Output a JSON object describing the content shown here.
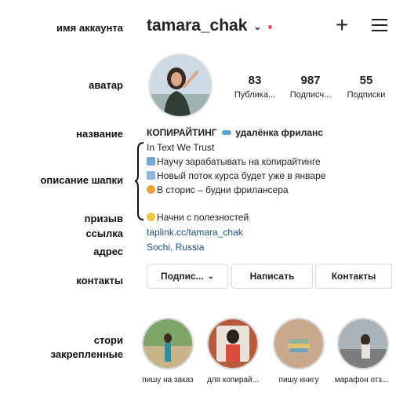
{
  "annotations": {
    "account_name": "имя аккаунта",
    "avatar": "аватар",
    "title": "название",
    "header_description": "описание шапки",
    "call_to_action": "призыв",
    "link": "ссылка",
    "address": "адрес",
    "contacts": "контакты",
    "stories_line1": "стори",
    "stories_line2": "закрепленные"
  },
  "header": {
    "username": "tamara_chak",
    "icons": [
      "chevron-down-icon",
      "notification-dot",
      "plus-icon",
      "menu-icon"
    ]
  },
  "stats": [
    {
      "value": "83",
      "label": "Публика..."
    },
    {
      "value": "987",
      "label": "Подписч..."
    },
    {
      "value": "55",
      "label": "Подписки"
    }
  ],
  "bio": {
    "name": "КОПИРАЙТИНГ",
    "category": "удалёнка фриланс",
    "lines": [
      "In Text We Trust",
      "Научу зарабатывать на копирайтинге",
      "Новый поток курса будет уже в январе",
      "В сторис – будни фрилансера",
      "Начни с полезностей"
    ],
    "link": "taplink.cc/tamara_chak",
    "address": "Sochi, Russia"
  },
  "buttons": {
    "subscribe": "Подпис...",
    "message": "Написать",
    "contacts": "Контакты"
  },
  "highlights": [
    {
      "label": "пишу на заказ"
    },
    {
      "label": "для копирай..."
    },
    {
      "label": "пишу книгу"
    },
    {
      "label": "марафон отз..."
    }
  ],
  "colors": {
    "link": "#1e4f8a",
    "notification_dot": "#ed4956",
    "border": "#dbdbdb"
  }
}
